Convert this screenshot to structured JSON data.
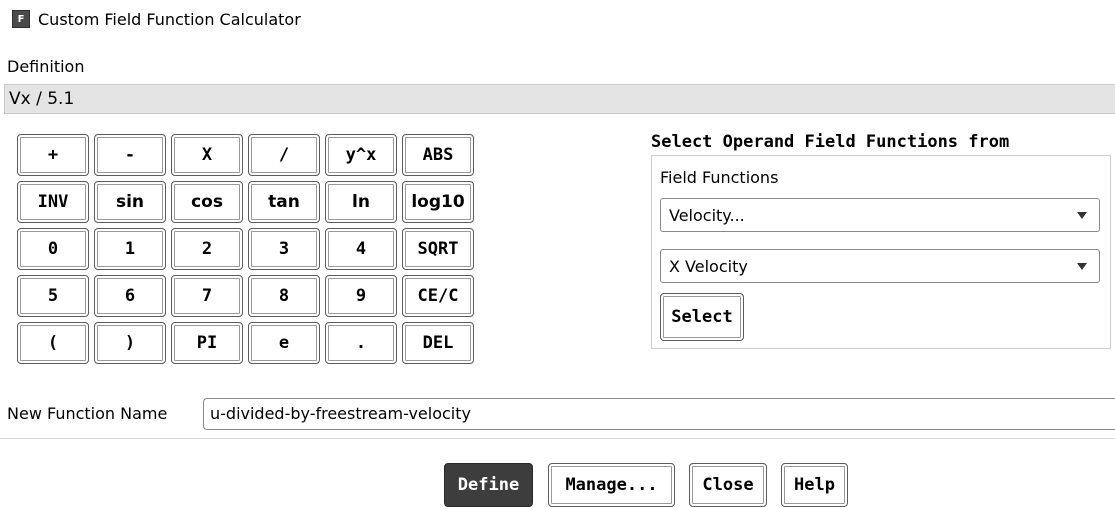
{
  "window": {
    "icon_letter": "F",
    "title": "Custom Field Function Calculator"
  },
  "definition": {
    "label": "Definition",
    "value": "Vx / 5.1"
  },
  "keypad": {
    "keys": [
      [
        "+",
        "-",
        "X",
        "/",
        "y^x",
        "ABS"
      ],
      [
        "INV",
        "sin",
        "cos",
        "tan",
        "ln",
        "log10"
      ],
      [
        "0",
        "1",
        "2",
        "3",
        "4",
        "SQRT"
      ],
      [
        "5",
        "6",
        "7",
        "8",
        "9",
        "CE/C"
      ],
      [
        "(",
        ")",
        "PI",
        "e",
        ".",
        "DEL"
      ]
    ]
  },
  "operand": {
    "title": "Select Operand Field Functions from",
    "field_functions_label": "Field Functions",
    "category_value": "Velocity...",
    "function_value": "X Velocity",
    "select_label": "Select"
  },
  "new_function": {
    "label": "New Function Name",
    "value": "u-divided-by-freestream-velocity"
  },
  "buttons": {
    "define": "Define",
    "manage": "Manage...",
    "close": "Close",
    "help": "Help"
  }
}
